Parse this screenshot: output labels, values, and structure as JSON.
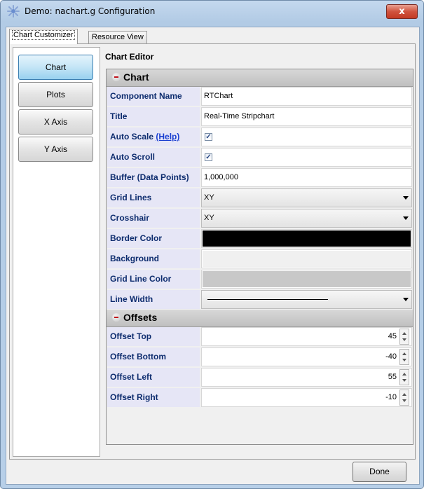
{
  "window": {
    "title": "Demo: nachart.g Configuration",
    "close_label": "x"
  },
  "tabs": [
    {
      "label": "Chart Customizer",
      "active": true
    },
    {
      "label": "Resource View",
      "active": false
    }
  ],
  "sidebar": {
    "items": [
      {
        "label": "Chart",
        "active": true
      },
      {
        "label": "Plots",
        "active": false
      },
      {
        "label": "X Axis",
        "active": false
      },
      {
        "label": "Y Axis",
        "active": false
      }
    ]
  },
  "editor": {
    "title": "Chart Editor",
    "sections": {
      "chart": {
        "label": "Chart",
        "rows": {
          "component_name": {
            "label": "Component Name",
            "value": "RTChart"
          },
          "title": {
            "label": "Title",
            "value": "Real-Time Stripchart"
          },
          "auto_scale": {
            "label": "Auto Scale",
            "help": "(Help)",
            "checked": true
          },
          "auto_scroll": {
            "label": "Auto Scroll",
            "checked": true
          },
          "buffer": {
            "label": "Buffer (Data Points)",
            "value": "1,000,000"
          },
          "grid_lines": {
            "label": "Grid Lines",
            "value": "XY"
          },
          "crosshair": {
            "label": "Crosshair",
            "value": "XY"
          },
          "border_color": {
            "label": "Border Color",
            "color": "#000000"
          },
          "background": {
            "label": "Background",
            "color": "#f0f0f0"
          },
          "grid_line_color": {
            "label": "Grid Line Color",
            "color": "#c8c8c8"
          },
          "line_width": {
            "label": "Line Width"
          }
        }
      },
      "offsets": {
        "label": "Offsets",
        "rows": {
          "top": {
            "label": "Offset Top",
            "value": "45"
          },
          "bottom": {
            "label": "Offset Bottom",
            "value": "-40"
          },
          "left": {
            "label": "Offset Left",
            "value": "55"
          },
          "right": {
            "label": "Offset Right",
            "value": "-10"
          }
        }
      }
    }
  },
  "footer": {
    "done_label": "Done"
  },
  "colors": {
    "label_text": "#0d2c6e",
    "label_bg": "#e6e6f6",
    "help_link": "#1a3fd1",
    "active_button": "#c4e5f6"
  }
}
